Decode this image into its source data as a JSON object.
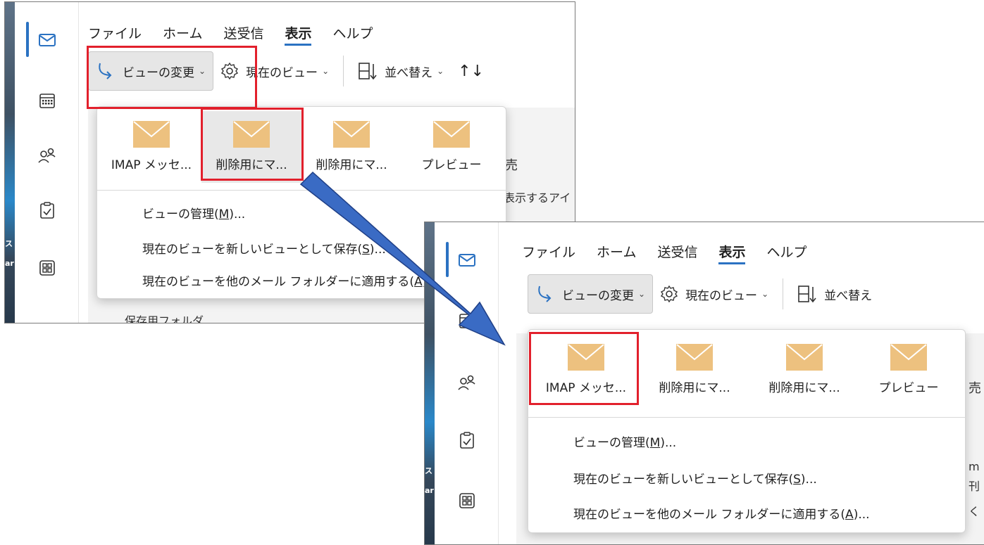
{
  "menu": {
    "file": "ファイル",
    "home": "ホーム",
    "send_receive": "送受信",
    "view": "表示",
    "help": "ヘルプ"
  },
  "ribbon": {
    "change_view": "ビューの変更",
    "current_view": "現在のビュー",
    "arrange": "並べ替え"
  },
  "views": [
    {
      "label": "IMAP メッセ..."
    },
    {
      "label": "削除用にマ..."
    },
    {
      "label": "削除用にマ..."
    },
    {
      "label": "プレビュー"
    }
  ],
  "dropdown": {
    "manage_pre": "ビューの管理(",
    "manage_key": "M",
    "manage_post": ")...",
    "save_pre": "現在のビューを新しいビューとして保存(",
    "save_key": "S",
    "save_post": ")...",
    "apply_pre": "現在のビューを他のメール フォルダーに適用する(",
    "apply_key": "A",
    "apply_post": ")..."
  },
  "background_fragments": {
    "shot1_right_a": "売",
    "shot1_right_b": "表示するアイ",
    "shot1_bottom": "保存用フォルダ",
    "shot2_right_a": "売",
    "shot2_right_b": "m",
    "shot2_right_c": "刊",
    "shot2_right_d": "く"
  },
  "colors": {
    "accent": "#2b72c2",
    "highlight_red": "#e2202c",
    "arrow_blue": "#3a6bc4",
    "envelope": "#edc17f"
  },
  "icons": [
    "mail-icon",
    "calendar-icon",
    "people-icon",
    "tasks-icon",
    "apps-icon",
    "change-view-icon",
    "gear-icon",
    "arrange-icon",
    "sort-icon",
    "envelope-icon"
  ]
}
